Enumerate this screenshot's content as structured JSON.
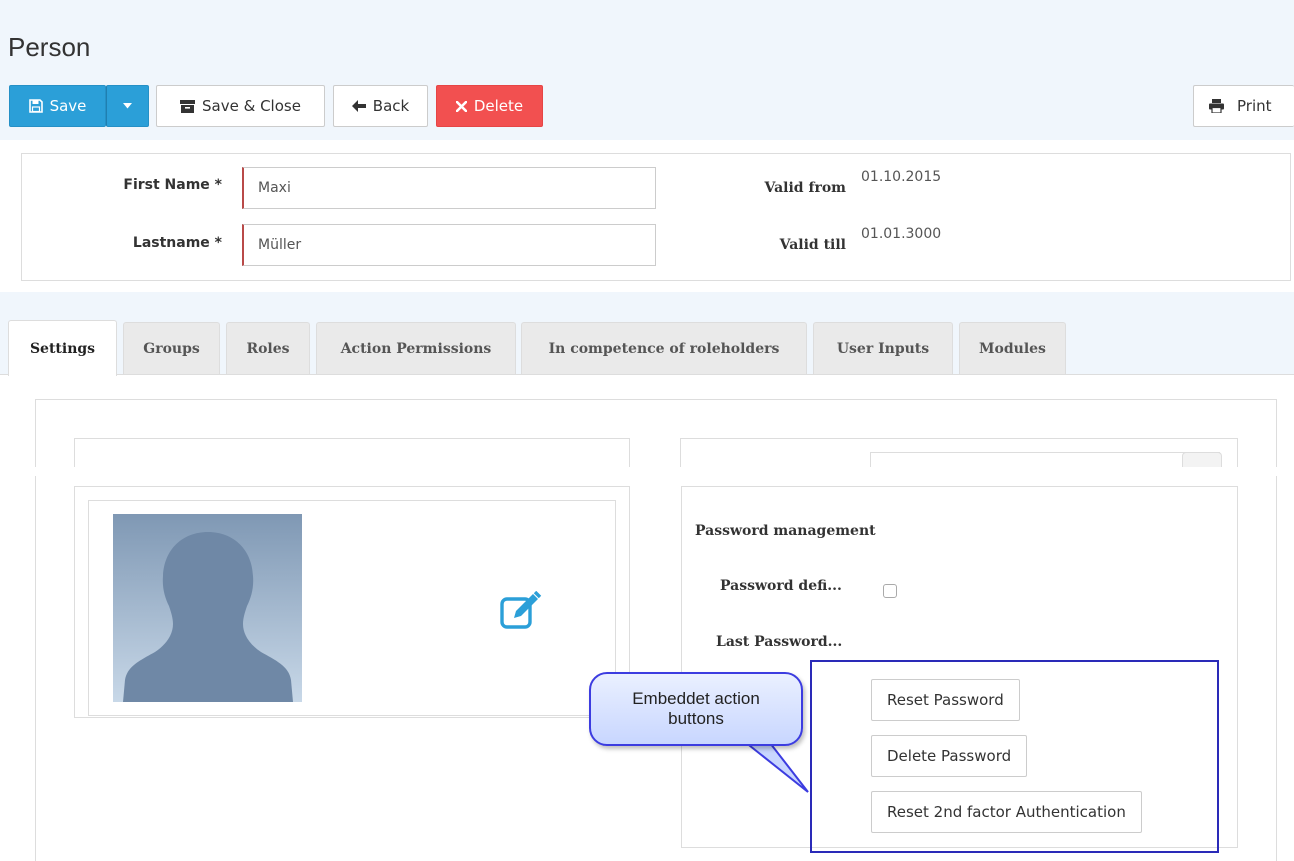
{
  "page": {
    "title": "Person"
  },
  "toolbar": {
    "save_label": "Save",
    "save_close_label": "Save & Close",
    "back_label": "Back",
    "delete_label": "Delete",
    "print_label": "Print"
  },
  "form": {
    "first_name_label": "First Name *",
    "first_name_value": "Maxi",
    "lastname_label": "Lastname *",
    "lastname_value": "Müller",
    "valid_from_label": "Valid from",
    "valid_from_value": "01.10.2015",
    "valid_till_label": "Valid till",
    "valid_till_value": "01.01.3000"
  },
  "tabs": [
    {
      "label": "Settings",
      "active": true
    },
    {
      "label": "Groups"
    },
    {
      "label": "Roles"
    },
    {
      "label": "Action Permissions"
    },
    {
      "label": "In competence of roleholders"
    },
    {
      "label": "User Inputs"
    },
    {
      "label": "Modules"
    }
  ],
  "password": {
    "heading": "Password management",
    "defined_label": "Password defi...",
    "last_label": "Last Password...",
    "reset_label": "Reset Password",
    "delete_label": "Delete Password",
    "reset_2fa_label": "Reset 2nd factor Authentication"
  },
  "callout": {
    "text_line1": "Embeddet action",
    "text_line2": "buttons"
  },
  "colors": {
    "primary": "#2b9fd8",
    "danger": "#f25050",
    "required": "#b94a48",
    "accent_icon": "#2b9fd8",
    "callout_border": "#2a2ab8"
  },
  "icons": {
    "save": "floppy-icon",
    "dropdown": "caret-down-icon",
    "save_close": "archive-icon",
    "back": "arrow-left-icon",
    "delete": "x-icon",
    "print": "printer-icon",
    "edit": "edit-square-icon",
    "avatar": "user-silhouette"
  }
}
